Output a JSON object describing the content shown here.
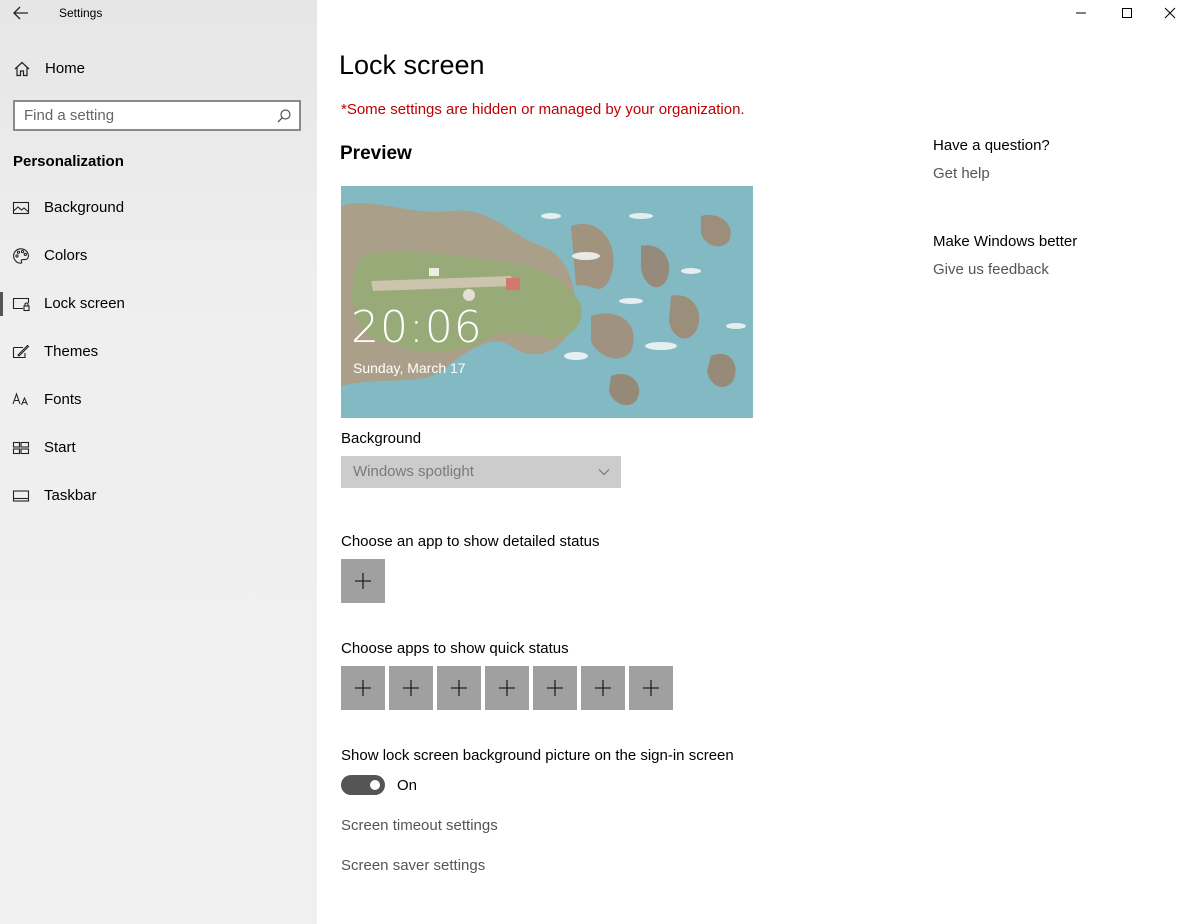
{
  "window": {
    "title": "Settings",
    "controls": [
      "minimize",
      "maximize",
      "close"
    ]
  },
  "sidebar": {
    "home_label": "Home",
    "search": {
      "placeholder": "Find a setting",
      "value": ""
    },
    "section_title": "Personalization",
    "items": [
      {
        "label": "Background",
        "icon": "picture-icon"
      },
      {
        "label": "Colors",
        "icon": "palette-icon"
      },
      {
        "label": "Lock screen",
        "icon": "lock-screen-icon",
        "active": true
      },
      {
        "label": "Themes",
        "icon": "brush-icon"
      },
      {
        "label": "Fonts",
        "icon": "font-icon"
      },
      {
        "label": "Start",
        "icon": "start-icon"
      },
      {
        "label": "Taskbar",
        "icon": "taskbar-icon"
      }
    ]
  },
  "main": {
    "title": "Lock screen",
    "managed_note": "*Some settings are hidden or managed by your organization.",
    "preview_heading": "Preview",
    "preview": {
      "time": "20:06",
      "date": "Sunday, March 17"
    },
    "background": {
      "label": "Background",
      "value": "Windows spotlight",
      "disabled": true
    },
    "detailed_status": {
      "label": "Choose an app to show detailed status",
      "tiles": 1
    },
    "quick_status": {
      "label": "Choose apps to show quick status",
      "tiles": 7
    },
    "signin_bg": {
      "label": "Show lock screen background picture on the sign-in screen",
      "state": "On",
      "on": true
    },
    "links": [
      "Screen timeout settings",
      "Screen saver settings"
    ]
  },
  "rail": {
    "question_heading": "Have a question?",
    "get_help": "Get help",
    "feedback_heading": "Make Windows better",
    "feedback_link": "Give us feedback"
  },
  "colors": {
    "warning": "#c00000",
    "toggle_on": "#555555",
    "tile": "#a0a0a0"
  }
}
